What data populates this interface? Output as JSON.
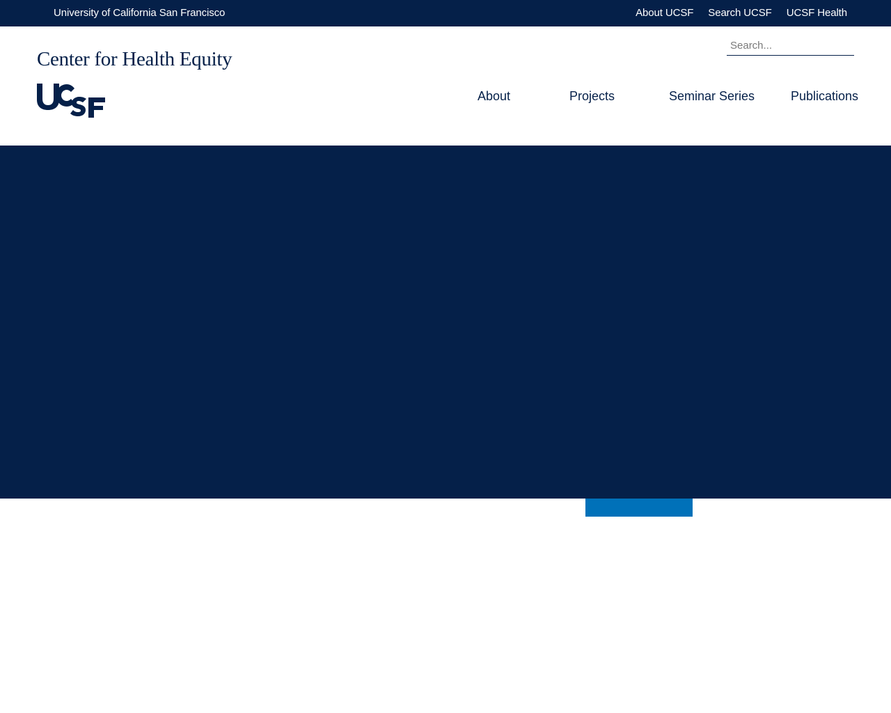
{
  "top_bar": {
    "university": "University of California San Francisco",
    "links": [
      "About UCSF",
      "Search UCSF",
      "UCSF Health"
    ]
  },
  "header": {
    "site_name": "Center for Health Equity",
    "logo_text": "UCSF",
    "search_placeholder": "Search..."
  },
  "nav": {
    "items": [
      "About",
      "Projects",
      "Seminar Series",
      "Publications"
    ]
  },
  "colors": {
    "navy": "#052049",
    "accent_blue": "#0071b9",
    "white": "#ffffff"
  }
}
